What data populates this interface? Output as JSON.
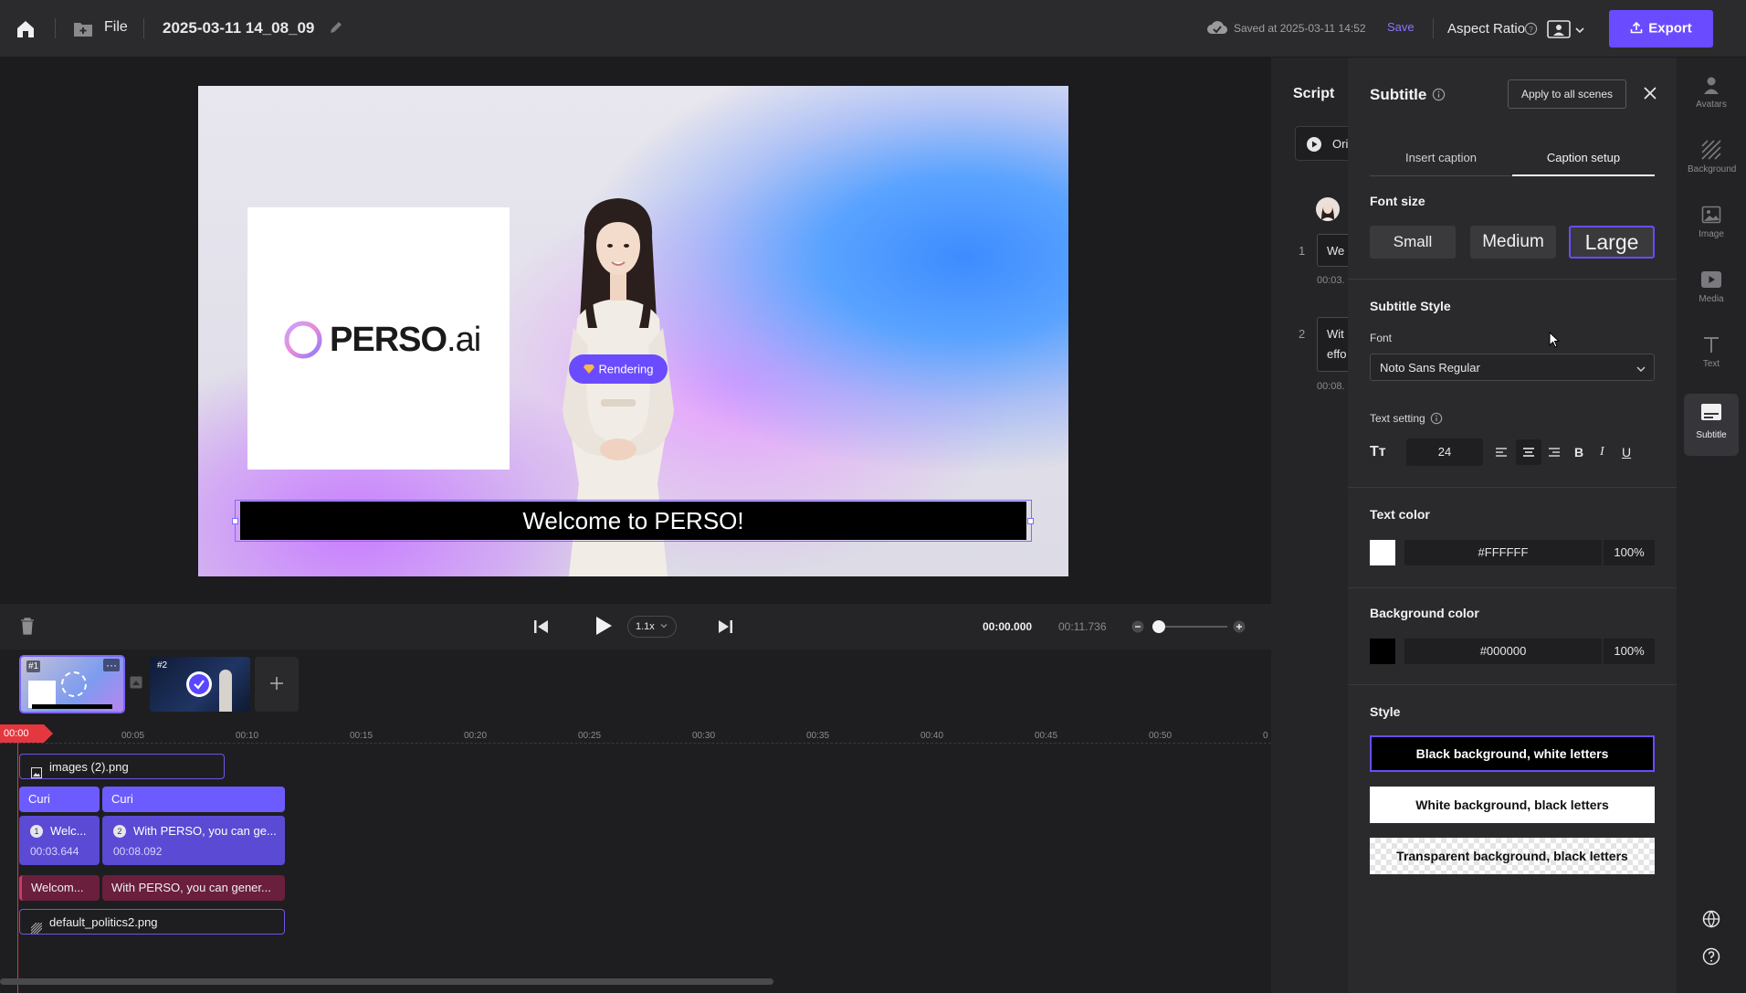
{
  "topbar": {
    "file_label": "File",
    "project_title": "2025-03-11 14_08_09",
    "saved_status": "Saved at 2025-03-11 14:52",
    "save_label": "Save",
    "aspect_ratio_label": "Aspect Ratio",
    "export_label": "Export"
  },
  "canvas": {
    "logo_text": "PERSO",
    "logo_suffix": ".ai",
    "rendering_badge": "Rendering",
    "subtitle_text": "Welcome to PERSO!"
  },
  "controls": {
    "speed": "1.1x",
    "current_time": "00:00.000",
    "total_time": "00:11.736"
  },
  "timeline": {
    "scenes": [
      {
        "label": "#1"
      },
      {
        "label": "#2"
      }
    ],
    "playhead": "00:00",
    "ticks": [
      "00:05",
      "00:10",
      "00:15",
      "00:20",
      "00:25",
      "00:30",
      "00:35",
      "00:40",
      "00:45",
      "00:50",
      "0"
    ],
    "image_track": "images (2).png",
    "avatar_clips": [
      "Curi",
      "Curi"
    ],
    "script_clips": [
      {
        "num": "1",
        "text": "Welc...",
        "time": "00:03.644"
      },
      {
        "num": "2",
        "text": "With PERSO, you can ge...",
        "time": "00:08.092"
      }
    ],
    "subtitle_clips": [
      "Welcom...",
      "With PERSO, you can gener..."
    ],
    "background_track": "default_politics2.png"
  },
  "script": {
    "title": "Script",
    "original_btn": "Ori",
    "rows": [
      {
        "num": "1",
        "text": "We",
        "time": "00:03."
      },
      {
        "num": "2",
        "text": "Wit",
        "text2": "effo",
        "time": "00:08."
      }
    ]
  },
  "subtitle_panel": {
    "title": "Subtitle",
    "apply_all": "Apply to all scenes",
    "tabs": [
      "Insert caption",
      "Caption setup"
    ],
    "font_size_label": "Font size",
    "font_sizes": [
      "Small",
      "Medium",
      "Large"
    ],
    "selected_font_size": "Large",
    "subtitle_style_label": "Subtitle Style",
    "font_label": "Font",
    "font_value": "Noto Sans Regular",
    "text_setting_label": "Text setting",
    "text_size": "24",
    "text_color_label": "Text color",
    "text_color_hex": "#FFFFFF",
    "text_color_opacity": "100%",
    "bg_color_label": "Background color",
    "bg_color_hex": "#000000",
    "bg_color_opacity": "100%",
    "style_label": "Style",
    "styles": [
      "Black background, white letters",
      "White background, black letters",
      "Transparent background, black letters"
    ]
  },
  "rail": {
    "items": [
      "Avatars",
      "Background",
      "Image",
      "Media",
      "Text",
      "Subtitle"
    ],
    "active": "Subtitle"
  },
  "colors": {
    "accent": "#6b4bff",
    "panel": "#2a2a2c",
    "playhead": "#e5373f"
  }
}
